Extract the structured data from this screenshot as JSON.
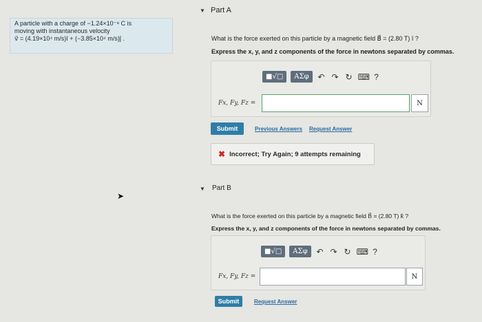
{
  "problem": {
    "line1": "A particle with a charge of −1.24×10⁻⁸ C is",
    "line2": "moving with instantaneous velocity",
    "line3": "v⃗ = (4.19×10⁴ m/s)î + (−3.85×10⁴ m/s)ĵ ."
  },
  "partA": {
    "title": "Part A",
    "question": "What is the force exerted on this particle by a magnetic field B⃗ = (2.80 T) î ?",
    "instruction": "Express the x, y, and z components of the force in newtons separated by commas.",
    "toolbar": {
      "matrix": "■√□",
      "greek": "AΣφ",
      "help": "?"
    },
    "eq_label": "Fx, Fy, Fz =",
    "input_value": "",
    "unit": "N",
    "submit": "Submit",
    "prev_answers": "Previous Answers",
    "request_answer": "Request Answer",
    "feedback": "Incorrect; Try Again; 9 attempts remaining"
  },
  "partB": {
    "title": "Part B",
    "question": "What is the force exerted on this particle by a magnetic field B⃗ = (2.80 T) k̂ ?",
    "instruction": "Express the x, y, and z components of the force in newtons separated by commas.",
    "toolbar": {
      "matrix": "■√□",
      "greek": "AΣφ",
      "help": "?"
    },
    "eq_label": "Fx, Fy, Fz =",
    "input_value": "",
    "unit": "N",
    "submit": "Submit",
    "request_answer": "Request Answer"
  }
}
